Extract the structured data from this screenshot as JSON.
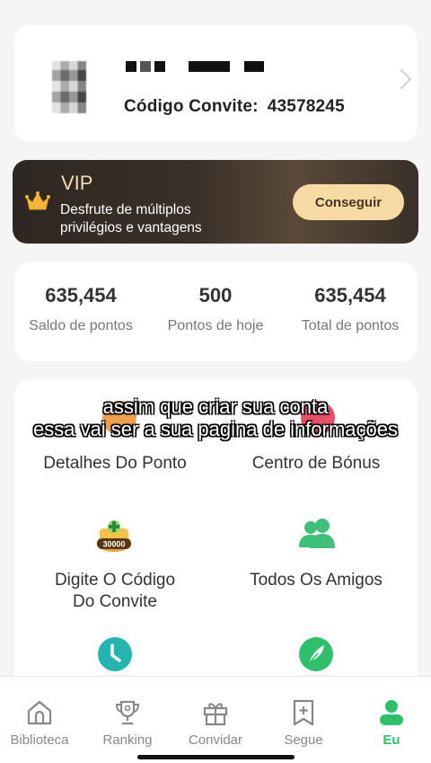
{
  "profile": {
    "invite_label": "Código Convite:",
    "invite_code": "43578245"
  },
  "vip": {
    "title": "VIP",
    "desc_line1": "Desfrute de múltiplos",
    "desc_line2": "privilégios e vantagens",
    "button": "Conseguir"
  },
  "stats": [
    {
      "value": "635,454",
      "label": "Saldo de pontos"
    },
    {
      "value": "500",
      "label": "Pontos de hoje"
    },
    {
      "value": "635,454",
      "label": "Total de pontos"
    }
  ],
  "menu": {
    "item1": "Detalhes Do Ponto",
    "item2": "Centro de Bónus",
    "item3_line1": "Digite O Código",
    "item3_line2": "Do Convite",
    "item3_badge": "30000",
    "item4": "Todos Os Amigos"
  },
  "subtitle": {
    "line1": "assim que criar sua conta",
    "line2": "essa vai ser a sua pagina de informações"
  },
  "tabs": [
    {
      "label": "Biblioteca",
      "icon": "home-icon"
    },
    {
      "label": "Ranking",
      "icon": "trophy-icon"
    },
    {
      "label": "Convidar",
      "icon": "gift-icon"
    },
    {
      "label": "Segue",
      "icon": "bookmark-plus-icon"
    },
    {
      "label": "Eu",
      "icon": "user-icon"
    }
  ],
  "colors": {
    "accent": "#2fbf6a",
    "vip_button": "#f7d9a4",
    "teal": "#23b5b0"
  }
}
